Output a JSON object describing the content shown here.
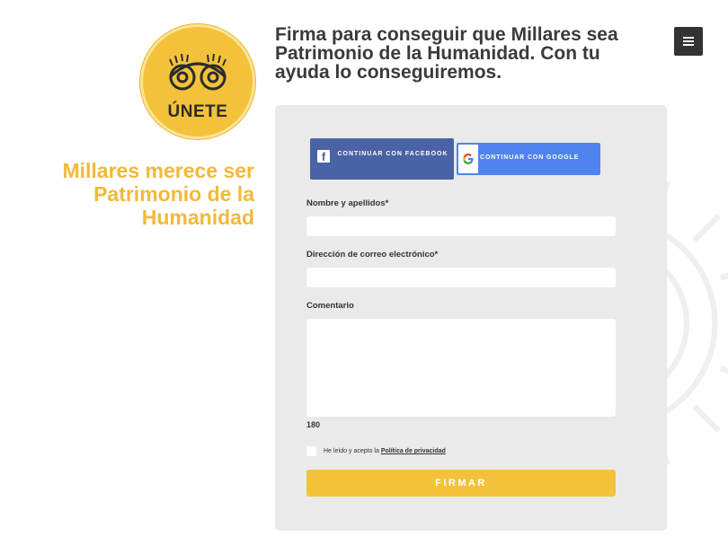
{
  "brand": {
    "logo_text": "ÚNETE",
    "logo_color": "#f4c23a",
    "accent_color": "#f2b93a"
  },
  "tagline": "Millares merece ser Patrimonio de la Humanidad",
  "headline": "Firma para conseguir que Millares sea Patrimonio de la Humanidad. Con tu ayuda lo conseguiremos.",
  "menu": {
    "icon": "hamburger-icon"
  },
  "social": {
    "facebook_label": "CONTINUAR CON FACEBOOK",
    "facebook_color": "#4a63a4",
    "google_label": "CONTINUAR CON GOOGLE",
    "google_color": "#4f83f0"
  },
  "form": {
    "name_label": "Nombre y apellidos*",
    "name_value": "",
    "email_label": "Dirección de correo electrónico*",
    "email_value": "",
    "comment_label": "Comentario",
    "comment_value": "",
    "char_counter": "180",
    "consent_prefix": "He leído y acepto la ",
    "privacy_link": "Política de privacidad",
    "consent_checked": false,
    "submit_label": "FIRMAR"
  }
}
